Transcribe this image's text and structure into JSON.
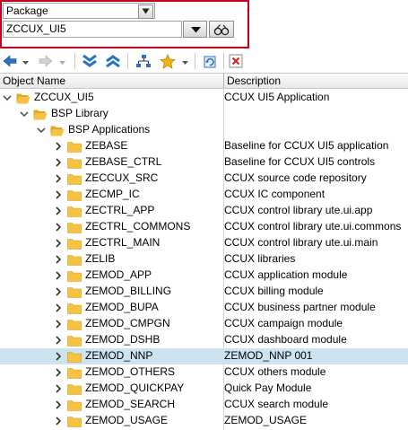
{
  "object_type": {
    "selected": "Package"
  },
  "package_input": {
    "value": "ZCCUX_UI5"
  },
  "toolbar": {
    "buttons": [
      {
        "name": "back-button",
        "icon": "arrow-left-icon"
      },
      {
        "name": "forward-button",
        "icon": "arrow-right-icon"
      },
      {
        "name": "expand-all-button",
        "icon": "double-chevron-down-icon"
      },
      {
        "name": "collapse-all-button",
        "icon": "double-chevron-up-icon"
      },
      {
        "name": "hierarchy-button",
        "icon": "hierarchy-icon"
      },
      {
        "name": "favorites-button",
        "icon": "star-icon"
      },
      {
        "name": "refresh-button",
        "icon": "refresh-icon"
      },
      {
        "name": "close-button",
        "icon": "close-icon"
      }
    ]
  },
  "tree": {
    "columns": [
      "Object Name",
      "Description"
    ],
    "rows": [
      {
        "name": "ZCCUX_UI5",
        "desc": "CCUX UI5 Application",
        "level": 0,
        "expanded": true,
        "selected": false
      },
      {
        "name": "BSP Library",
        "desc": "",
        "level": 1,
        "expanded": true,
        "selected": false
      },
      {
        "name": "BSP Applications",
        "desc": "",
        "level": 2,
        "expanded": true,
        "selected": false
      },
      {
        "name": "ZEBASE",
        "desc": "Baseline for CCUX UI5 application",
        "level": 3,
        "expanded": false,
        "selected": false
      },
      {
        "name": "ZEBASE_CTRL",
        "desc": "Baseline for CCUX UI5 controls",
        "level": 3,
        "expanded": false,
        "selected": false
      },
      {
        "name": "ZECCUX_SRC",
        "desc": "CCUX source code repository",
        "level": 3,
        "expanded": false,
        "selected": false
      },
      {
        "name": "ZECMP_IC",
        "desc": "CCUX IC component",
        "level": 3,
        "expanded": false,
        "selected": false
      },
      {
        "name": "ZECTRL_APP",
        "desc": "CCUX control library ute.ui.app",
        "level": 3,
        "expanded": false,
        "selected": false
      },
      {
        "name": "ZECTRL_COMMONS",
        "desc": "CCUX control library ute.ui.commons",
        "level": 3,
        "expanded": false,
        "selected": false
      },
      {
        "name": "ZECTRL_MAIN",
        "desc": "CCUX control library ute.ui.main",
        "level": 3,
        "expanded": false,
        "selected": false
      },
      {
        "name": "ZELIB",
        "desc": "CCUX libraries",
        "level": 3,
        "expanded": false,
        "selected": false
      },
      {
        "name": "ZEMOD_APP",
        "desc": "CCUX application module",
        "level": 3,
        "expanded": false,
        "selected": false
      },
      {
        "name": "ZEMOD_BILLING",
        "desc": "CCUX billing module",
        "level": 3,
        "expanded": false,
        "selected": false
      },
      {
        "name": "ZEMOD_BUPA",
        "desc": "CCUX business partner module",
        "level": 3,
        "expanded": false,
        "selected": false
      },
      {
        "name": "ZEMOD_CMPGN",
        "desc": "CCUX campaign module",
        "level": 3,
        "expanded": false,
        "selected": false
      },
      {
        "name": "ZEMOD_DSHB",
        "desc": "CCUX dashboard module",
        "level": 3,
        "expanded": false,
        "selected": false
      },
      {
        "name": "ZEMOD_NNP",
        "desc": "ZEMOD_NNP 001",
        "level": 3,
        "expanded": false,
        "selected": true
      },
      {
        "name": "ZEMOD_OTHERS",
        "desc": "CCUX others module",
        "level": 3,
        "expanded": false,
        "selected": false
      },
      {
        "name": "ZEMOD_QUICKPAY",
        "desc": "Quick Pay Module",
        "level": 3,
        "expanded": false,
        "selected": false
      },
      {
        "name": "ZEMOD_SEARCH",
        "desc": "CCUX search module",
        "level": 3,
        "expanded": false,
        "selected": false
      },
      {
        "name": "ZEMOD_USAGE",
        "desc": "ZEMOD_USAGE",
        "level": 3,
        "expanded": false,
        "selected": false
      }
    ]
  },
  "colors": {
    "highlight_border": "#c5001a",
    "selected_row": "#cde3ef",
    "folder": "#f5c242",
    "toolbar_blue": "#2a72c4"
  }
}
